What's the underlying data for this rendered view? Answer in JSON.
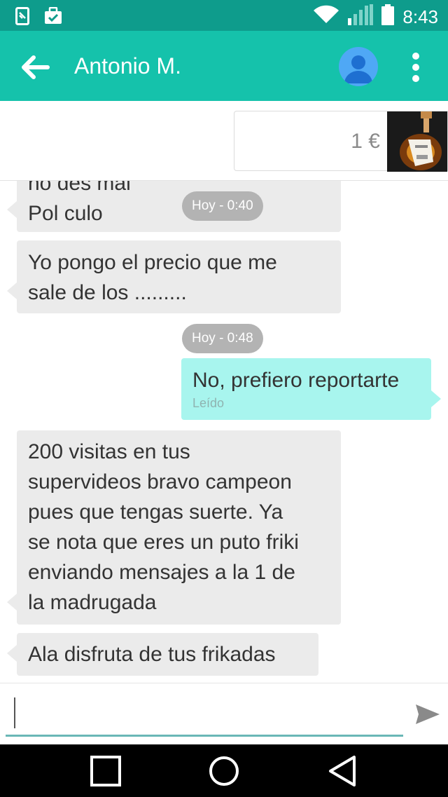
{
  "status_bar": {
    "time": "8:43",
    "icons": [
      "sim-card-icon",
      "briefcase-icon",
      "wifi-icon",
      "signal-icon",
      "battery-icon"
    ]
  },
  "header": {
    "contact_name": "Antonio M.",
    "icons": [
      "back-arrow-icon",
      "avatar-icon",
      "overflow-menu-icon"
    ],
    "colors": {
      "app_bar": "#15c2ab",
      "status_bar": "#0e9c8c"
    }
  },
  "product": {
    "price": "1 €",
    "image": "guitar-thumbnail"
  },
  "messages": [
    {
      "dir": "in",
      "lines": [
        "no des mal",
        "Pol culo"
      ]
    },
    {
      "chip": "Hoy - 0:40"
    },
    {
      "dir": "in",
      "lines": [
        "Yo pongo el precio que me",
        "sale de los ........."
      ]
    },
    {
      "chip": "Hoy - 0:48"
    },
    {
      "dir": "out",
      "lines": [
        "No, prefiero reportarte"
      ],
      "status": "Leído"
    },
    {
      "dir": "in",
      "lines": [
        "200 visitas en tus",
        "supervideos bravo campeon",
        "pues que tengas suerte. Ya",
        "se nota que eres un puto friki",
        "enviando mensajes a la 1 de",
        "la madrugada"
      ]
    },
    {
      "dir": "in",
      "lines": [
        "Ala disfruta de tus frikadas"
      ]
    }
  ],
  "composer": {
    "placeholder": "",
    "send_icon": "send-icon"
  },
  "nav_bar": {
    "icons": [
      "recents-icon",
      "home-icon",
      "back-icon"
    ]
  }
}
